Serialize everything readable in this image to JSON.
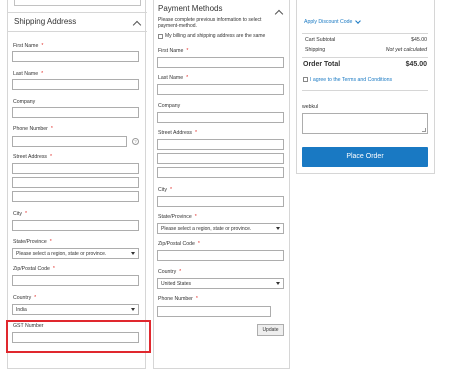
{
  "shipping": {
    "title": "Shipping Address",
    "fields": {
      "first_name": {
        "label": "First Name",
        "required": "*"
      },
      "last_name": {
        "label": "Last Name",
        "required": "*"
      },
      "company": {
        "label": "Company"
      },
      "phone": {
        "label": "Phone Number",
        "required": "*"
      },
      "street": {
        "label": "Street Address",
        "required": "*"
      },
      "city": {
        "label": "City",
        "required": "*"
      },
      "region": {
        "label": "State/Province",
        "required": "*",
        "value": "Please select a region, state or province."
      },
      "zip": {
        "label": "Zip/Postal Code",
        "required": "*"
      },
      "country": {
        "label": "Country",
        "required": "*",
        "value": "India"
      },
      "gst": {
        "label": "GST Number"
      }
    },
    "help_glyph": "?"
  },
  "payment": {
    "title": "Payment Methods",
    "info": "Please complete previous information to select payment-method.",
    "same_address_label": "My billing and shipping address are the same",
    "fields": {
      "first_name": {
        "label": "First Name",
        "required": "*"
      },
      "last_name": {
        "label": "Last Name",
        "required": "*"
      },
      "company": {
        "label": "Company"
      },
      "street": {
        "label": "Street Address",
        "required": "*"
      },
      "city": {
        "label": "City",
        "required": "*"
      },
      "region": {
        "label": "State/Province",
        "required": "*",
        "value": "Please select a region, state or province."
      },
      "zip": {
        "label": "Zip/Postal Code",
        "required": "*"
      },
      "country": {
        "label": "Country",
        "required": "*",
        "value": "United States"
      },
      "phone": {
        "label": "Phone Number",
        "required": "*"
      }
    },
    "update_label": "Update"
  },
  "summary": {
    "discount_label": "Apply Discount Code",
    "rows": [
      {
        "label": "Cart Subtotal",
        "value": "$45.00"
      },
      {
        "label": "Shipping",
        "value": "Not yet calculated"
      }
    ],
    "total_label": "Order Total",
    "total_value": "$45.00",
    "terms_label": "I agree to the Terms and Conditions",
    "comment_label": "webkul",
    "place_order_label": "Place Order"
  },
  "colors": {
    "accent": "#1979c3",
    "highlight": "#e0282e",
    "required": "#e02b27"
  }
}
